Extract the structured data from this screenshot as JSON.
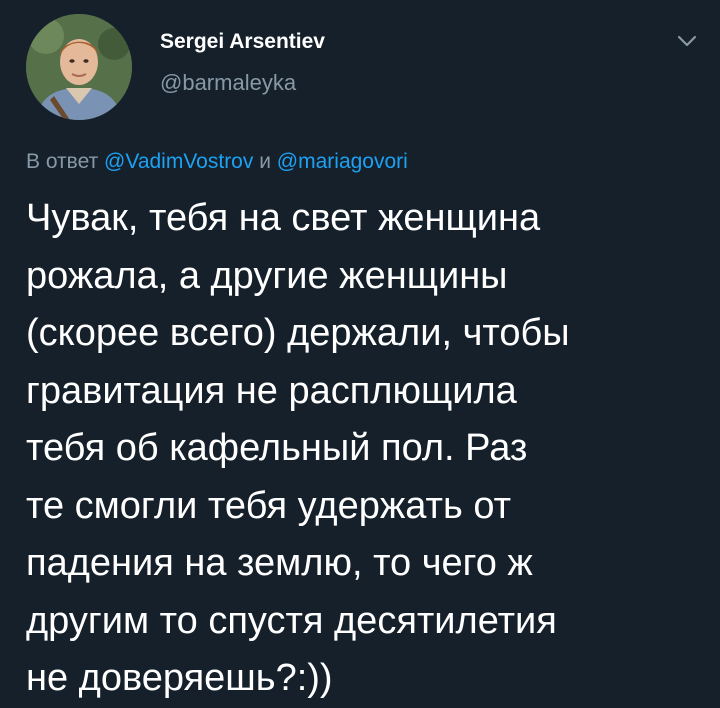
{
  "tweet": {
    "author": {
      "display_name": "Sergei Arsentiev",
      "handle": "@barmaleyka"
    },
    "reply": {
      "prefix": "В ответ",
      "mention1": "@VadimVostrov",
      "conjunction": "и",
      "mention2": "@mariagovori"
    },
    "text_lines": [
      "Чувак, тебя на свет женщина",
      "рожала, а другие женщины",
      "(скорее всего) держали, чтобы",
      "гравитация не расплющила",
      "тебя об кафельный пол. Раз",
      "те смогли тебя удержать от",
      "падения на землю, то чего ж",
      "другим то спустя десятилетия",
      "не доверяешь?:))"
    ],
    "menu_icon": "chevron-down-icon"
  },
  "colors": {
    "background": "#15202b",
    "text": "#ffffff",
    "secondary_text": "#8899a6",
    "link": "#1da1f2"
  }
}
